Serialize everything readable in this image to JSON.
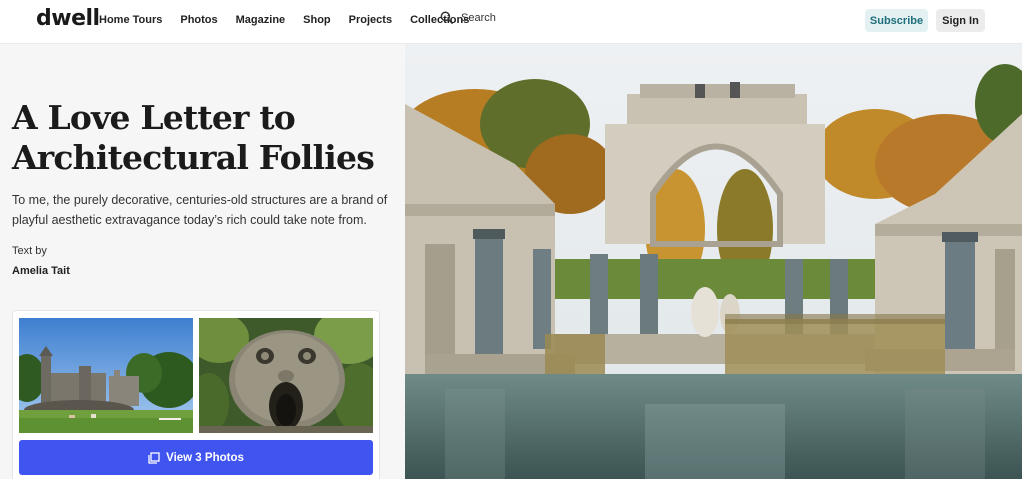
{
  "header": {
    "logo": "dwell",
    "nav": [
      "Home Tours",
      "Photos",
      "Magazine",
      "Shop",
      "Projects",
      "Collections"
    ],
    "search_label": "Search",
    "subscribe_label": "Subscribe",
    "signin_label": "Sign In"
  },
  "article": {
    "title": "A Love Letter to Architectural Follies",
    "dek": "To me, the purely decorative, centuries-old structures are a brand of playful aesthetic extravagance today’s rich could take note from.",
    "byline_label": "Text by",
    "author": "Amelia Tait"
  },
  "gallery": {
    "view_label": "View 3 Photos"
  },
  "colors": {
    "accent": "#4054f0",
    "subscribe_bg": "#e3f1f2",
    "subscribe_text": "#1f6f7a"
  },
  "icons": [
    "search-icon",
    "photos-icon"
  ]
}
